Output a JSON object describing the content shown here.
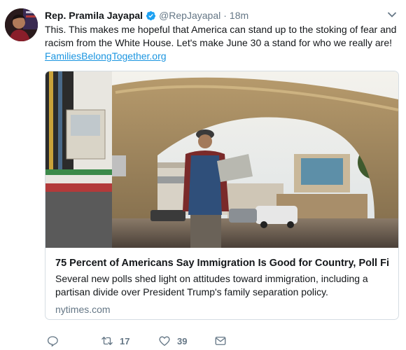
{
  "tweet": {
    "author_name": "Rep. Pramila Jayapal",
    "handle": "@RepJayapal",
    "separator": "·",
    "time": "18m",
    "text": "This. This makes me hopeful that America can stand up to the stoking of fear and racism from the White House. Let's make June 30 a stand for who we really are!",
    "link": "FamiliesBelongTogether.org"
  },
  "card": {
    "title": "75 Percent of Americans Say Immigration Is Good for Country, Poll Fi...",
    "description": "Several new polls shed light on attitudes toward immigration, including a partisan divide over President Trump's family separation policy.",
    "domain": "nytimes.com"
  },
  "actions": {
    "reply_count": "",
    "retweet_count": "17",
    "like_count": "39"
  },
  "colors": {
    "link": "#1b95e0",
    "secondary": "#657786",
    "verified": "#1da1f2",
    "border": "#d5dde3"
  },
  "icons": [
    "verified-badge-icon",
    "caret-down-icon",
    "reply-icon",
    "retweet-icon",
    "like-icon",
    "direct-message-icon"
  ]
}
